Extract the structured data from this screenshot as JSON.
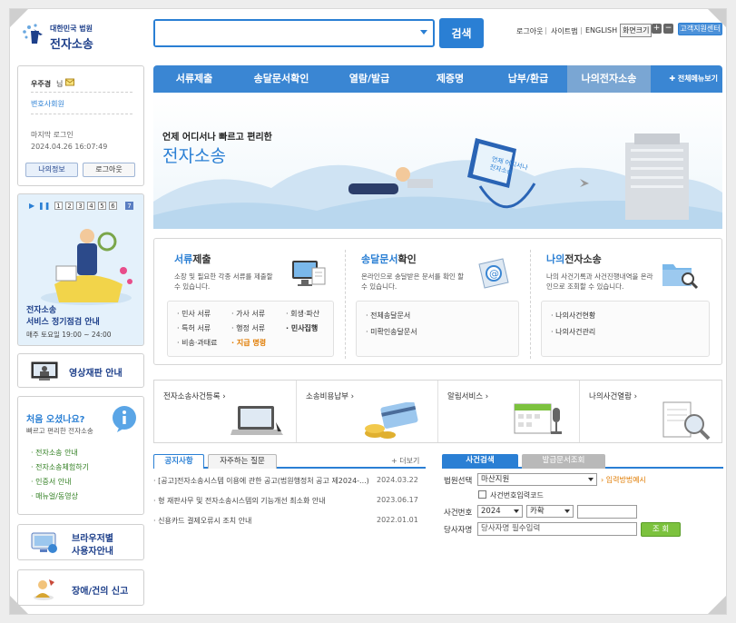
{
  "header": {
    "logo_sub": "대한민국 법원",
    "logo_main": "전자소송",
    "search_placeholder": "",
    "search_button": "검색",
    "links": [
      "로그아웃",
      "사이트맵",
      "ENGLISH"
    ],
    "zoom_label": "화면크기",
    "zoom_plus": "+",
    "zoom_minus": "−",
    "help_button": "고객지원센터"
  },
  "user_box": {
    "name": "우주경",
    "name_suffix": "님",
    "lawyer_link": "변호사회원",
    "last_login_label": "마지막 로그인",
    "last_login_time": "2024.04.26 16:07:49",
    "my_info_button": "나의정보",
    "logout_button": "로그아웃"
  },
  "promo": {
    "pages": [
      "1",
      "2",
      "3",
      "4",
      "5",
      "6",
      "7"
    ],
    "active_page": 7,
    "title_line1": "전자소송",
    "title_line2": "서비스 정기점검 안내",
    "detail": "매주 토요일 19:00 ~ 24:00"
  },
  "video_trial": {
    "label": "영상재판 안내"
  },
  "first_visit": {
    "title": "처음 오셨나요?",
    "subtitle": "빠르고 편리한 전자소송",
    "items": [
      "전자소송 안내",
      "전자소송체험하기",
      "인증서 안내",
      "매뉴얼/동영상"
    ]
  },
  "browser_guide": {
    "line1": "브라우저별",
    "line2": "사용자안내"
  },
  "error_report": {
    "label": "장애/건의 신고"
  },
  "nav": {
    "items": [
      "서류제출",
      "송달문서확인",
      "열람/발급",
      "제증명",
      "납부/환급",
      "나의전자소송"
    ],
    "active_index": 5,
    "all_menu": "전체메뉴보기"
  },
  "banner": {
    "line1": "언제 어디서나 빠르고 편리한",
    "line2": "전자소송",
    "sign_text": "언제 어디서나\n전자소송"
  },
  "services": [
    {
      "title_strong": "서류",
      "title_rest": "제출",
      "desc": "소장 및 필요한 각종 서류를 제출할 수 있습니다.",
      "links": [
        "민사 서류",
        "가사 서류",
        "회생·파산",
        "특허 서류",
        "행정 서류",
        "민사집행",
        "비송·과태료",
        "지급 명령"
      ]
    },
    {
      "title_strong": "송달문서",
      "title_rest": "확인",
      "desc": "온라인으로 송달받은 문서를 확인 할 수 있습니다.",
      "links": [
        "전체송달문서",
        "미확인송달문서"
      ]
    },
    {
      "title_strong": "나의",
      "title_rest": "전자소송",
      "desc": "나의 사건기록과 사건진행내역을 온라인으로 조회할 수 있습니다.",
      "links": [
        "나의사건현황",
        "나의사건관리"
      ]
    }
  ],
  "quick_links": [
    {
      "label": "전자소송사건등록"
    },
    {
      "label": "소송비용납부"
    },
    {
      "label": "알림서비스"
    },
    {
      "label": "나의사건열람"
    }
  ],
  "notice_tabs": [
    "공지사항",
    "자주하는 질문"
  ],
  "notice_more": "더보기",
  "notices": [
    {
      "title": "[공고]전자소송시스템 이용에 관한 공고(법원행정처 공고 제2024-...)",
      "date": "2024.03.22"
    },
    {
      "title": "형 재판사무 및 전자소송시스템의 기능개선 최소화 안내",
      "date": "2023.06.17"
    },
    {
      "title": "신용카드 결제오류시 조치 안내",
      "date": "2022.01.01"
    }
  ],
  "case_search": {
    "tabs": [
      "사건검색",
      "발급문서조회"
    ],
    "court_label": "법원선택",
    "court_value": "마산지원",
    "input_hint": "입력방법예시",
    "checkbox_label": "사건번호입력코드",
    "case_no_label": "사건번호",
    "year_value": "2024",
    "type_value": "카확",
    "party_label": "당사자명",
    "party_placeholder": "당사자명 필수입력",
    "search_button": "조 회"
  },
  "colors": {
    "brand_blue": "#2a7fd4",
    "nav_blue": "#3a86d3",
    "accent_orange": "#e07b00",
    "go_green": "#7cc23e"
  }
}
